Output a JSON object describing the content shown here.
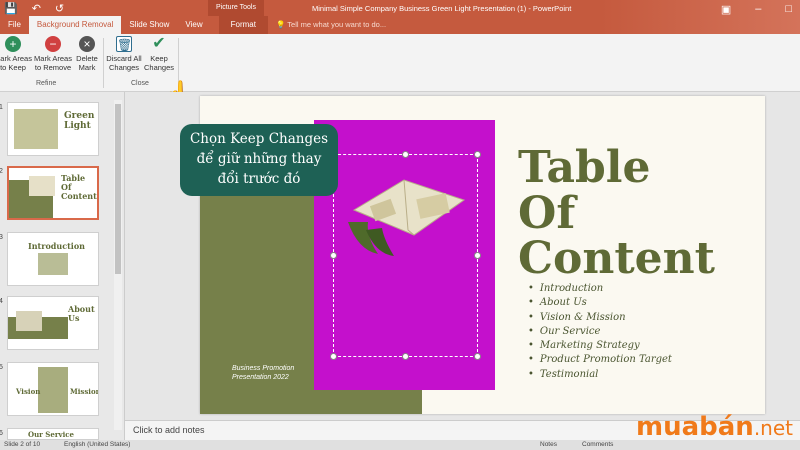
{
  "app": {
    "title": "Minimal Simple Company Business Green Light Presentation (1) - PowerPoint",
    "picture_tools": "Picture Tools",
    "tell_me": "Tell me what you want to do...",
    "accent": "#c55a3e"
  },
  "tabs": [
    "File",
    "Background Removal",
    "Slide Show",
    "View",
    "Format"
  ],
  "ribbon": {
    "refine_group": "Refine",
    "close_group": "Close",
    "buttons": [
      {
        "label1": "Mark Areas",
        "label2": "to Keep",
        "icon": "plus-circle-icon"
      },
      {
        "label1": "Mark Areas",
        "label2": "to Remove",
        "icon": "minus-circle-icon"
      },
      {
        "label1": "Delete",
        "label2": "Mark",
        "icon": "delete-mark-icon"
      },
      {
        "label1": "Discard All",
        "label2": "Changes",
        "icon": "trash-icon"
      },
      {
        "label1": "Keep",
        "label2": "Changes",
        "icon": "checkmark-icon"
      }
    ]
  },
  "thumbnails": [
    {
      "num": "1",
      "text1": "Green",
      "text2": "Light"
    },
    {
      "num": "2",
      "text1": "Table",
      "text2": "Of",
      "text3": "Content"
    },
    {
      "num": "3",
      "text1": "Introduction"
    },
    {
      "num": "4",
      "text1": "About",
      "text2": "Us"
    },
    {
      "num": "5",
      "text1": "Vision",
      "text2": "Mission"
    },
    {
      "num": "6",
      "text1": "Our Service"
    }
  ],
  "slide": {
    "line1": "Table",
    "line2": "Of",
    "line3": "Content",
    "items": [
      "Introduction",
      "About Us",
      "Vision & Mission",
      "Our Service",
      "Marketing Strategy",
      "Product Promotion Target",
      "Testimonial"
    ],
    "promo1": "Business Promotion",
    "promo2": "Presentation 2022"
  },
  "callout": {
    "line1": "Chọn Keep Changes",
    "line2": "để giữ những thay",
    "line3": "đổi trước đó"
  },
  "notes": "Click to add notes",
  "status": {
    "slide_num": "Slide 2 of 10",
    "language": "English (United States)",
    "notes": "Notes",
    "comments": "Comments"
  },
  "watermark": {
    "brand": "muabán",
    "tld": ".net"
  }
}
